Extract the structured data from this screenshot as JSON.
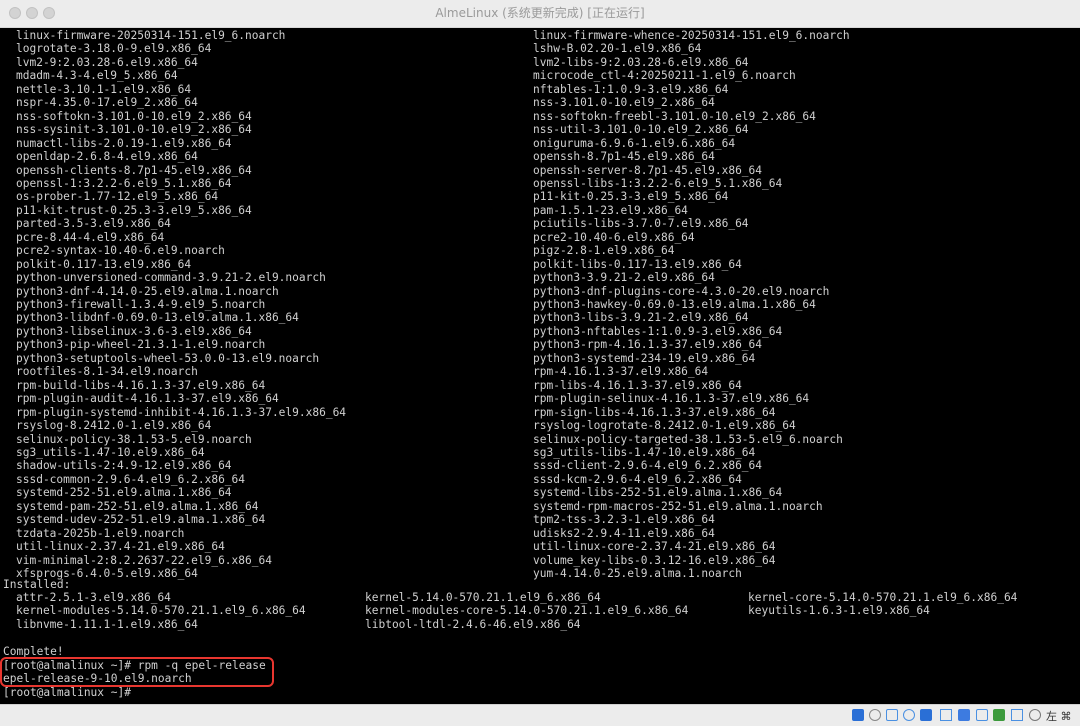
{
  "window": {
    "title": "AlmeLinux (系统更新完成) [正在运行]"
  },
  "terminal": {
    "packages_left": [
      "linux-firmware-20250314-151.el9_6.noarch",
      "logrotate-3.18.0-9.el9.x86_64",
      "lvm2-9:2.03.28-6.el9.x86_64",
      "mdadm-4.3-4.el9_5.x86_64",
      "nettle-3.10.1-1.el9.x86_64",
      "nspr-4.35.0-17.el9_2.x86_64",
      "nss-softokn-3.101.0-10.el9_2.x86_64",
      "nss-sysinit-3.101.0-10.el9_2.x86_64",
      "numactl-libs-2.0.19-1.el9.x86_64",
      "openldap-2.6.8-4.el9.x86_64",
      "openssh-clients-8.7p1-45.el9.x86_64",
      "openssl-1:3.2.2-6.el9_5.1.x86_64",
      "os-prober-1.77-12.el9_5.x86_64",
      "p11-kit-trust-0.25.3-3.el9_5.x86_64",
      "parted-3.5-3.el9.x86_64",
      "pcre-8.44-4.el9.x86_64",
      "pcre2-syntax-10.40-6.el9.noarch",
      "polkit-0.117-13.el9.x86_64",
      "python-unversioned-command-3.9.21-2.el9.noarch",
      "python3-dnf-4.14.0-25.el9.alma.1.noarch",
      "python3-firewall-1.3.4-9.el9_5.noarch",
      "python3-libdnf-0.69.0-13.el9.alma.1.x86_64",
      "python3-libselinux-3.6-3.el9.x86_64",
      "python3-pip-wheel-21.3.1-1.el9.noarch",
      "python3-setuptools-wheel-53.0.0-13.el9.noarch",
      "rootfiles-8.1-34.el9.noarch",
      "rpm-build-libs-4.16.1.3-37.el9.x86_64",
      "rpm-plugin-audit-4.16.1.3-37.el9.x86_64",
      "rpm-plugin-systemd-inhibit-4.16.1.3-37.el9.x86_64",
      "rsyslog-8.2412.0-1.el9.x86_64",
      "selinux-policy-38.1.53-5.el9.noarch",
      "sg3_utils-1.47-10.el9.x86_64",
      "shadow-utils-2:4.9-12.el9.x86_64",
      "sssd-common-2.9.6-4.el9_6.2.x86_64",
      "systemd-252-51.el9.alma.1.x86_64",
      "systemd-pam-252-51.el9.alma.1.x86_64",
      "systemd-udev-252-51.el9.alma.1.x86_64",
      "tzdata-2025b-1.el9.noarch",
      "util-linux-2.37.4-21.el9.x86_64",
      "vim-minimal-2:8.2.2637-22.el9_6.x86_64",
      "xfsprogs-6.4.0-5.el9.x86_64"
    ],
    "packages_right": [
      "linux-firmware-whence-20250314-151.el9_6.noarch",
      "lshw-B.02.20-1.el9.x86_64",
      "lvm2-libs-9:2.03.28-6.el9.x86_64",
      "microcode_ctl-4:20250211-1.el9_6.noarch",
      "nftables-1:1.0.9-3.el9.x86_64",
      "nss-3.101.0-10.el9_2.x86_64",
      "nss-softokn-freebl-3.101.0-10.el9_2.x86_64",
      "nss-util-3.101.0-10.el9_2.x86_64",
      "oniguruma-6.9.6-1.el9.6.x86_64",
      "openssh-8.7p1-45.el9.x86_64",
      "openssh-server-8.7p1-45.el9.x86_64",
      "openssl-libs-1:3.2.2-6.el9_5.1.x86_64",
      "p11-kit-0.25.3-3.el9_5.x86_64",
      "pam-1.5.1-23.el9.x86_64",
      "pciutils-libs-3.7.0-7.el9.x86_64",
      "pcre2-10.40-6.el9.x86_64",
      "pigz-2.8-1.el9.x86_64",
      "polkit-libs-0.117-13.el9.x86_64",
      "python3-3.9.21-2.el9.x86_64",
      "python3-dnf-plugins-core-4.3.0-20.el9.noarch",
      "python3-hawkey-0.69.0-13.el9.alma.1.x86_64",
      "python3-libs-3.9.21-2.el9.x86_64",
      "python3-nftables-1:1.0.9-3.el9.x86_64",
      "python3-rpm-4.16.1.3-37.el9.x86_64",
      "python3-systemd-234-19.el9.x86_64",
      "rpm-4.16.1.3-37.el9.x86_64",
      "rpm-libs-4.16.1.3-37.el9.x86_64",
      "rpm-plugin-selinux-4.16.1.3-37.el9.x86_64",
      "rpm-sign-libs-4.16.1.3-37.el9.x86_64",
      "rsyslog-logrotate-8.2412.0-1.el9.x86_64",
      "selinux-policy-targeted-38.1.53-5.el9_6.noarch",
      "sg3_utils-libs-1.47-10.el9.x86_64",
      "sssd-client-2.9.6-4.el9_6.2.x86_64",
      "sssd-kcm-2.9.6-4.el9_6.2.x86_64",
      "systemd-libs-252-51.el9.alma.1.x86_64",
      "systemd-rpm-macros-252-51.el9.alma.1.noarch",
      "tpm2-tss-3.2.3-1.el9.x86_64",
      "udisks2-2.9.4-11.el9.x86_64",
      "util-linux-core-2.37.4-21.el9.x86_64",
      "volume_key-libs-0.3.12-16.el9.x86_64",
      "yum-4.14.0-25.el9.alma.1.noarch"
    ],
    "installed_header": "Installed:",
    "installed_rows": [
      [
        "attr-2.5.1-3.el9.x86_64",
        "kernel-5.14.0-570.21.1.el9_6.x86_64",
        "kernel-core-5.14.0-570.21.1.el9_6.x86_64"
      ],
      [
        "kernel-modules-5.14.0-570.21.1.el9_6.x86_64",
        "kernel-modules-core-5.14.0-570.21.1.el9_6.x86_64",
        "keyutils-1.6.3-1.el9.x86_64"
      ],
      [
        "libnvme-1.11.1-1.el9.x86_64",
        "libtool-ltdl-2.4.6-46.el9.x86_64",
        ""
      ]
    ],
    "complete": "Complete!",
    "command_line": "[root@almalinux ~]# rpm -q epel-release",
    "command_output": "epel-release-9-10.el9.noarch",
    "prompt": "[root@almalinux ~]#"
  },
  "statusbar": {
    "host_key": "左 ⌘"
  },
  "colors": {
    "terminal_bg": "#000000",
    "terminal_fg": "#d0d0d0",
    "highlight": "#e8362f"
  }
}
